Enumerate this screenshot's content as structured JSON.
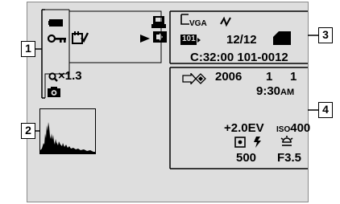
{
  "callouts": {
    "c1": "1",
    "c2": "2",
    "c3": "3",
    "c4": "4"
  },
  "group3": {
    "image_size": "VGA",
    "folder": "101",
    "image_count": "12/12",
    "file_number": "C:32:00 101-0012"
  },
  "group1": {
    "zoom": "×1.3"
  },
  "group4": {
    "date_year": "2006",
    "date_month": "1",
    "date_day": "1",
    "time": "9:30",
    "ampm": "AM",
    "exposure": "+2.0EV",
    "iso_prefix": "ISO",
    "iso_value": "400",
    "shutter": "500",
    "aperture": "F3.5"
  },
  "icons": [
    "battery-icon",
    "protect-key-icon",
    "print-order-icon",
    "memory-card-icon",
    "play-icon",
    "volume-icon",
    "zoom-magnifier-icon",
    "camera-mode-icon",
    "image-size-icon",
    "quality-icon",
    "folder-icon",
    "card-media-icon",
    "pictbridge-icon",
    "metering-spot-icon",
    "flash-icon",
    "white-balance-icon",
    "histogram"
  ]
}
